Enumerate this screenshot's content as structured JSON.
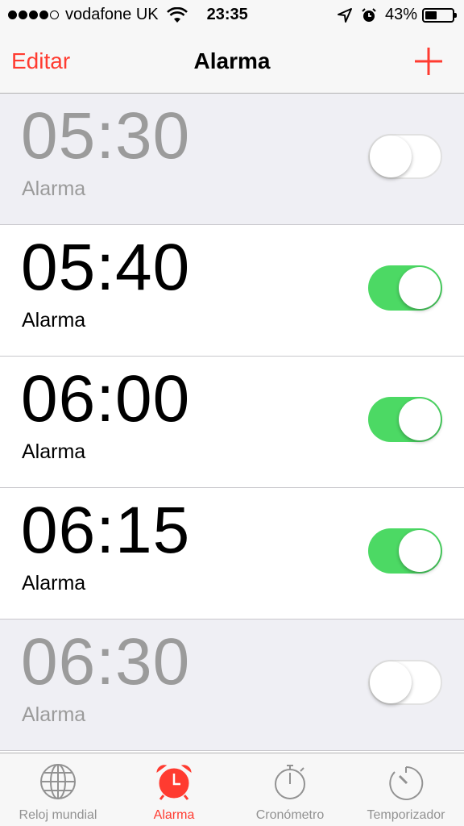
{
  "status": {
    "carrier": "vodafone UK",
    "time": "23:35",
    "battery": "43%",
    "battery_level": 0.43,
    "signal_bars": 4
  },
  "nav": {
    "edit": "Editar",
    "title": "Alarma",
    "add_icon": "plus-icon"
  },
  "alarms": [
    {
      "time": "05:30",
      "label": "Alarma",
      "enabled": false
    },
    {
      "time": "05:40",
      "label": "Alarma",
      "enabled": true
    },
    {
      "time": "06:00",
      "label": "Alarma",
      "enabled": true
    },
    {
      "time": "06:15",
      "label": "Alarma",
      "enabled": true
    },
    {
      "time": "06:30",
      "label": "Alarma",
      "enabled": false
    }
  ],
  "tabs": [
    {
      "label": "Reloj mundial",
      "icon": "globe-icon",
      "active": false
    },
    {
      "label": "Alarma",
      "icon": "alarm-clock-icon",
      "active": true
    },
    {
      "label": "Cronómetro",
      "icon": "stopwatch-icon",
      "active": false
    },
    {
      "label": "Temporizador",
      "icon": "timer-icon",
      "active": false
    }
  ],
  "colors": {
    "accent": "#ff3b30",
    "toggle_on": "#4cd964",
    "disabled_row": "#efeff4"
  }
}
